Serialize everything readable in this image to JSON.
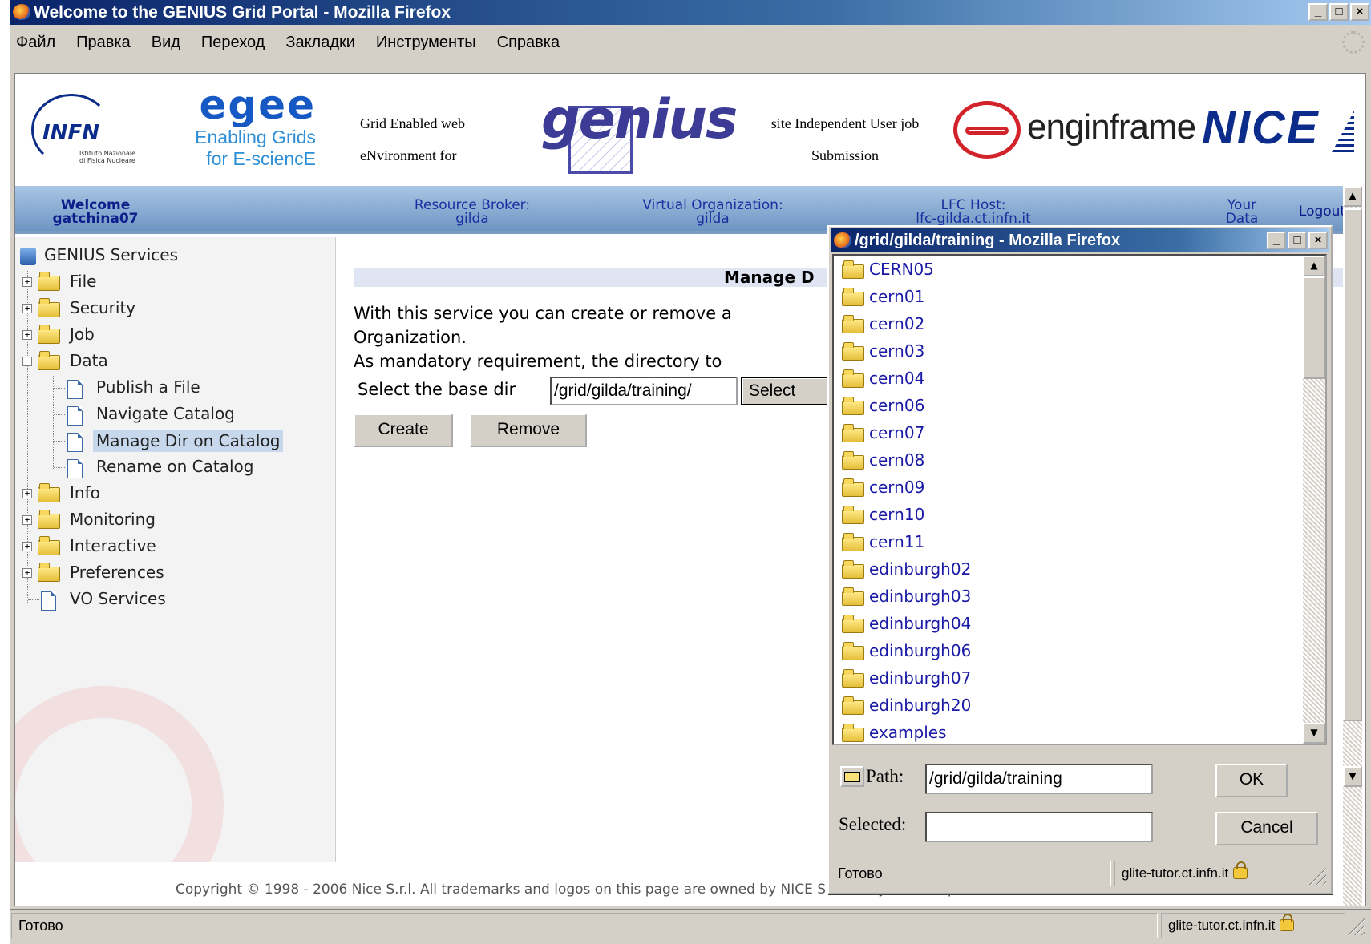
{
  "browser": {
    "title": "Welcome to the GENIUS Grid Portal - Mozilla Firefox",
    "window_buttons": [
      "_",
      "□",
      "×"
    ],
    "menu": [
      "Файл",
      "Правка",
      "Вид",
      "Переход",
      "Закладки",
      "Инструменты",
      "Справка"
    ],
    "status_text": "Готово",
    "status_host": "glite-tutor.ct.infn.it"
  },
  "banner": {
    "infn_logo": "INFN",
    "infn_sub1": "Istituto Nazionale",
    "infn_sub2": "di Fisica Nucleare",
    "egee_logo": "egee",
    "egee_sub1": "Enabling Grids",
    "egee_sub2": "for E-sciencE",
    "genius_text1": "Grid Enabled web",
    "genius_text2": "eNvironment for",
    "genius_logo": "genius",
    "genius_text3": "site Independent User job",
    "genius_text4": "Submission",
    "enginframe_logo": "enginframe",
    "nice_logo": "NICE"
  },
  "header": {
    "welcome": "Welcome",
    "user": "gatchina07",
    "rb_label": "Resource Broker:",
    "rb_value": "gilda",
    "vo_label": "Virtual Organization:",
    "vo_value": "gilda",
    "lfc_label": "LFC Host:",
    "lfc_value": "lfc-gilda.ct.infn.it",
    "your_data1": "Your",
    "your_data2": "Data",
    "logout": "Logout"
  },
  "sidebar": {
    "root": "GENIUS Services",
    "items": [
      "File",
      "Security",
      "Job",
      "Data",
      "Publish a File",
      "Navigate Catalog",
      "Manage Dir on Catalog",
      "Rename on Catalog",
      "Info",
      "Monitoring",
      "Interactive",
      "Preferences",
      "VO Services"
    ],
    "selected": "Manage Dir on Catalog"
  },
  "main": {
    "heading": "Manage D",
    "desc_line1": "With this service you can create or remove a",
    "desc_line2": "Organization.",
    "desc_line3": "As mandatory requirement, the directory to",
    "base_dir_label": "Select the base dir",
    "base_dir_value": "/grid/gilda/training/",
    "select_button": "Select",
    "create_button": "Create",
    "remove_button": "Remove"
  },
  "footer": {
    "copyright": "Copyright © 1998 - 2006 Nice S.r.l. All trademarks and logos on this page are owned by NICE S.r.l. or by their respective owners."
  },
  "popup": {
    "title": "/grid/gilda/training - Mozilla Firefox",
    "folders": [
      "CERN05",
      "cern01",
      "cern02",
      "cern03",
      "cern04",
      "cern06",
      "cern07",
      "cern08",
      "cern09",
      "cern10",
      "cern11",
      "edinburgh02",
      "edinburgh03",
      "edinburgh04",
      "edinburgh06",
      "edinburgh07",
      "edinburgh20",
      "examples"
    ],
    "path_label": "Path:",
    "path_value": "/grid/gilda/training",
    "selected_label": "Selected:",
    "selected_value": "",
    "ok_button": "OK",
    "cancel_button": "Cancel",
    "status_text": "Готово",
    "status_host": "glite-tutor.ct.infn.it"
  }
}
